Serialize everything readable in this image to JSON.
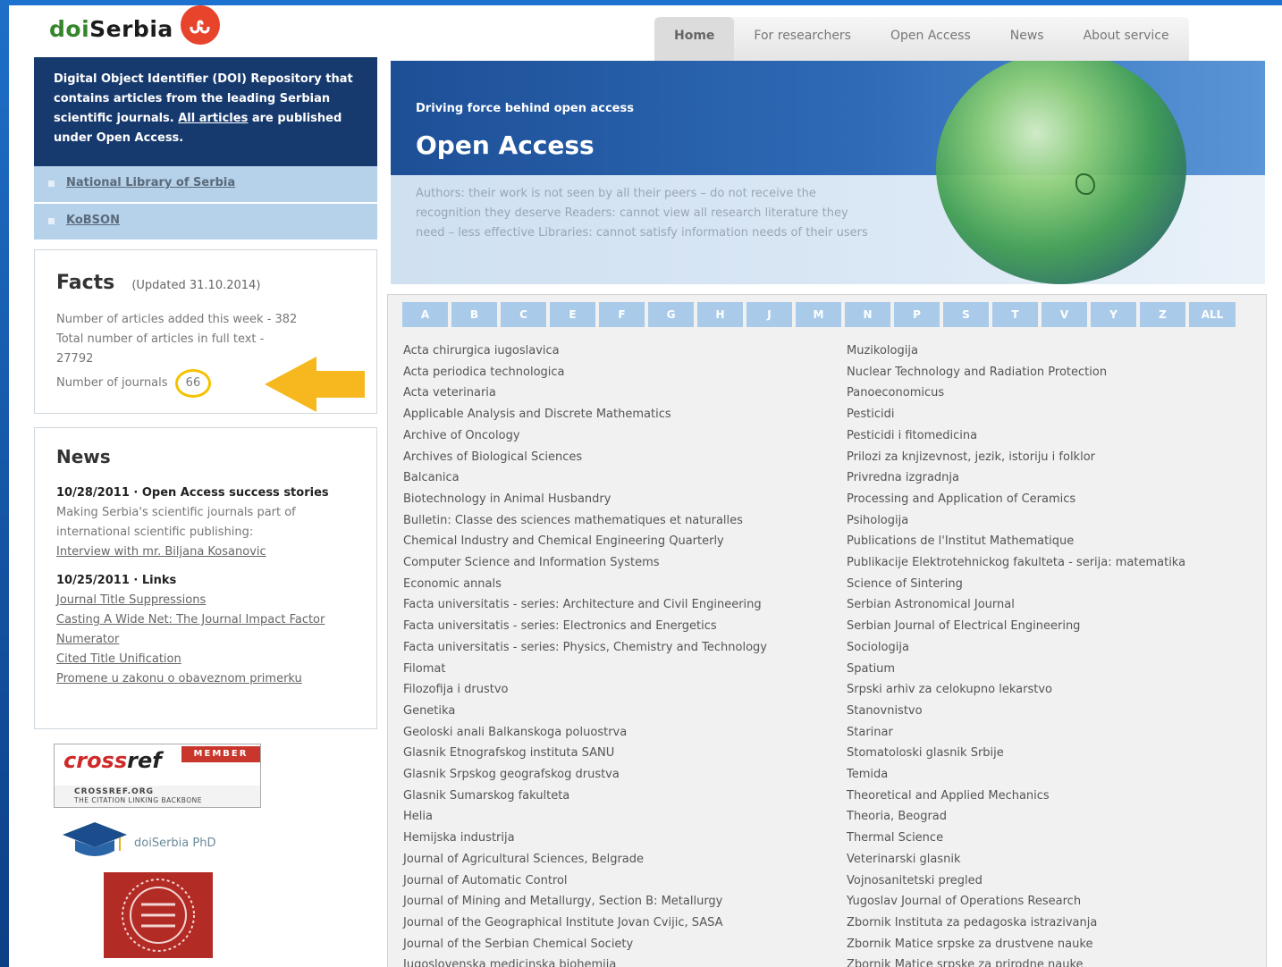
{
  "site": {
    "logo_doi": "doi",
    "logo_serbia": "Serbia",
    "logo_icon": "ஃ"
  },
  "nav": [
    "Home",
    "For researchers",
    "Open Access",
    "News",
    "About service"
  ],
  "intro": {
    "text_before": "Digital Object Identifier (DOI) Repository that contains articles from the leading Serbian scientific journals. ",
    "link": "All articles",
    "text_after": " are published under Open Access."
  },
  "sidebar_links": [
    "National Library of Serbia",
    "KoBSON"
  ],
  "facts": {
    "title": "Facts",
    "updated": "(Updated 31.10.2014)",
    "articles_week": "Number of articles added this week - 382",
    "articles_total_label": "Total number of articles in full text -",
    "articles_total_value": "27792",
    "journals_label": "Number of journals",
    "journals_value": "66"
  },
  "news": {
    "title": "News",
    "item1": {
      "title": "10/28/2011 · Open Access success stories",
      "text": "Making Serbia's scientific journals part of international scientific publishing:",
      "link": "Interview with mr. Biljana Kosanovic"
    },
    "item2": {
      "title": "10/25/2011 · Links",
      "links": [
        "Journal Title Suppressions",
        "Casting A Wide Net: The Journal Impact Factor Numerator",
        "Cited Title Unification",
        "Promene u zakonu o obaveznom primerku"
      ]
    }
  },
  "crossref": {
    "cross": "cross",
    "ref": "ref",
    "member": "MEMBER",
    "org": "CROSSREF.ORG",
    "tagline": "THE CITATION LINKING BACKBONE"
  },
  "phd_label": "doiSerbia PhD",
  "banner": {
    "subtitle": "Driving force behind open access",
    "title": "Open Access",
    "text": "Authors: their work is not seen by all their peers – do not receive the recognition they deserve Readers: cannot view all research literature they need – less effective Libraries: cannot satisfy information needs of their users"
  },
  "letters": [
    "A",
    "B",
    "C",
    "E",
    "F",
    "G",
    "H",
    "J",
    "M",
    "N",
    "P",
    "S",
    "T",
    "V",
    "Y",
    "Z",
    "ALL"
  ],
  "journals_col1": [
    "Acta chirurgica iugoslavica",
    "Acta periodica technologica",
    "Acta veterinaria",
    "Applicable Analysis and Discrete Mathematics",
    "Archive of Oncology",
    "Archives of Biological Sciences",
    "Balcanica",
    "Biotechnology in Animal Husbandry",
    "Bulletin: Classe des sciences mathematiques et naturalles",
    "Chemical Industry and Chemical Engineering Quarterly",
    "Computer Science and Information Systems",
    "Economic annals",
    "Facta universitatis - series: Architecture and Civil Engineering",
    "Facta universitatis - series: Electronics and Energetics",
    "Facta universitatis - series: Physics, Chemistry and Technology",
    "Filomat",
    "Filozofija i drustvo",
    "Genetika",
    "Geoloski anali Balkanskoga poluostrva",
    "Glasnik Etnografskog instituta SANU",
    "Glasnik Srpskog geografskog drustva",
    "Glasnik Sumarskog fakulteta",
    "Helia",
    "Hemijska industrija",
    "Journal of Agricultural Sciences, Belgrade",
    "Journal of Automatic Control",
    "Journal of Mining and Metallurgy, Section B: Metallurgy",
    "Journal of the Geographical Institute Jovan Cvijic, SASA",
    "Journal of the Serbian Chemical Society",
    "Jugoslovenska medicinska biohemija"
  ],
  "journals_col2": [
    "Muzikologija",
    "Nuclear Technology and Radiation Protection",
    "Panoeconomicus",
    "Pesticidi",
    "Pesticidi i fitomedicina",
    "Prilozi za knjizevnost, jezik, istoriju i folklor",
    "Privredna izgradnja",
    "Processing and Application of Ceramics",
    "Psihologija",
    "Publications de l'Institut Mathematique",
    "Publikacije Elektrotehnickog fakulteta - serija: matematika",
    "Science of Sintering",
    "Serbian Astronomical Journal",
    "Serbian Journal of Electrical Engineering",
    "Sociologija",
    "Spatium",
    "Srpski arhiv za celokupno lekarstvo",
    "Stanovnistvo",
    "Starinar",
    "Stomatoloski glasnik Srbije",
    "Temida",
    "Theoretical and Applied Mechanics",
    "Theoria, Beograd",
    "Thermal Science",
    "Veterinarski glasnik",
    "Vojnosanitetski pregled",
    "Yugoslav Journal of Operations Research",
    "Zbornik Instituta za pedagoska istrazivanja",
    "Zbornik Matice srpske za drustvene nauke",
    "Zbornik Matice srpske za prirodne nauke"
  ]
}
